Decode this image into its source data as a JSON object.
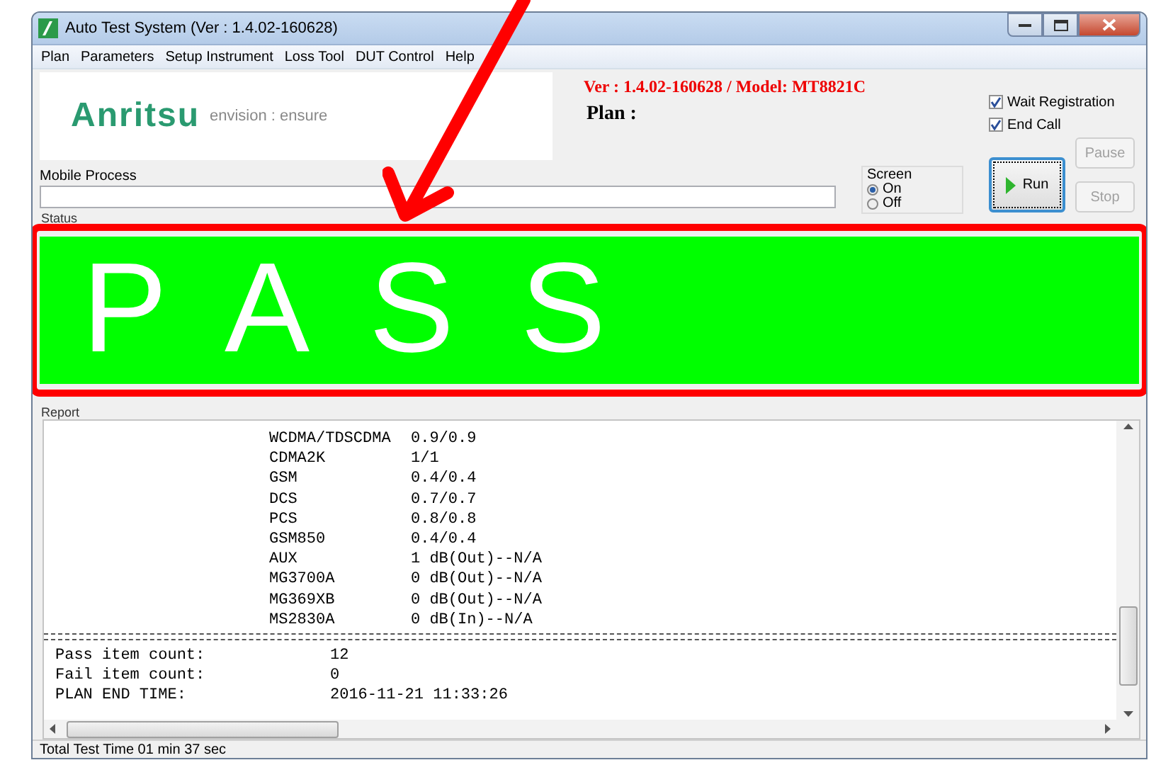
{
  "window": {
    "title": "Auto Test System (Ver : 1.4.02-160628)"
  },
  "menu": [
    {
      "label": "Plan"
    },
    {
      "label": "Parameters"
    },
    {
      "label": "Setup Instrument"
    },
    {
      "label": "Loss Tool"
    },
    {
      "label": "DUT Control"
    },
    {
      "label": "Help"
    }
  ],
  "header": {
    "logo": "Anritsu",
    "tagline": "envision : ensure",
    "version": "Ver : 1.4.02-160628 / Model: MT8821C",
    "plan_label": "Plan :"
  },
  "options": [
    {
      "label": "Wait Registration",
      "checked": true
    },
    {
      "label": "End Call",
      "checked": true
    }
  ],
  "mobile_process": {
    "label": "Mobile Process"
  },
  "screen": {
    "title": "Screen",
    "options": [
      {
        "label": "On",
        "selected": true
      },
      {
        "label": "Off",
        "selected": false
      }
    ]
  },
  "buttons": [
    {
      "label": "Pause",
      "kind": "pause",
      "disabled": true
    },
    {
      "label": "Run",
      "kind": "run",
      "disabled": false
    },
    {
      "label": "Stop",
      "kind": "stop",
      "disabled": true
    }
  ],
  "status": {
    "label": "Status",
    "result": "P A S S",
    "passed": true
  },
  "report": {
    "label": "Report",
    "rows": [
      {
        "name": "WCDMA/TDSCDMA",
        "value": "0.9/0.9"
      },
      {
        "name": "CDMA2K",
        "value": "1/1"
      },
      {
        "name": "GSM",
        "value": "0.4/0.4"
      },
      {
        "name": "DCS",
        "value": "0.7/0.7"
      },
      {
        "name": "PCS",
        "value": "0.8/0.8"
      },
      {
        "name": "GSM850",
        "value": "0.4/0.4"
      },
      {
        "name": "AUX",
        "value": "1 dB(Out)--N/A"
      },
      {
        "name": "MG3700A",
        "value": "0 dB(Out)--N/A"
      },
      {
        "name": "MG369XB",
        "value": "0 dB(Out)--N/A"
      },
      {
        "name": "MS2830A",
        "value": "0 dB(In)--N/A"
      }
    ],
    "summary": [
      {
        "label": "Pass item count:",
        "value": "12"
      },
      {
        "label": "Fail item count:",
        "value": "0"
      },
      {
        "label": "PLAN END TIME:",
        "value": "2016-11-21 11:33:26"
      }
    ]
  },
  "status_bar": {
    "text": "Total Test Time 01 min 37 sec"
  }
}
